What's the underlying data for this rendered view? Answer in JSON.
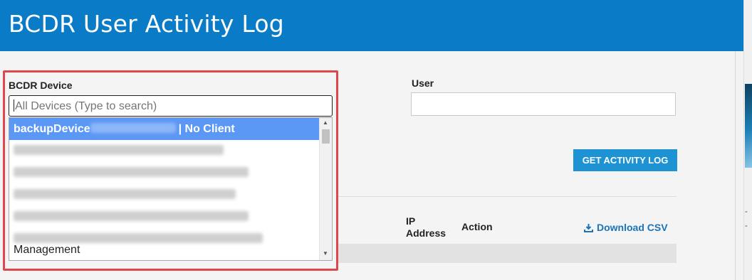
{
  "header": {
    "title": "BCDR User Activity Log"
  },
  "filters": {
    "device_label": "BCDR Device",
    "device_placeholder": "All Devices (Type to search)",
    "user_label": "User",
    "user_value": "",
    "get_button": "GET ACTIVITY LOG"
  },
  "dropdown": {
    "options": [
      {
        "name": "backupDevice",
        "suffix": "| No Client"
      },
      {
        "name": "",
        "suffix": ""
      },
      {
        "name": "",
        "suffix": ""
      },
      {
        "name": "",
        "suffix": ""
      },
      {
        "name": "",
        "suffix": ""
      },
      {
        "name": "",
        "suffix": ""
      }
    ],
    "wrap_text": "Management"
  },
  "table": {
    "col_ip": "IP Address",
    "col_ip_line1": "IP",
    "col_ip_line2": "Address",
    "col_action": "Action",
    "download_label": "Download CSV"
  },
  "colors": {
    "header": "#0a7bc7",
    "button": "#1d93d4",
    "selected": "#5b97f4",
    "highlight": "#e0474c"
  }
}
